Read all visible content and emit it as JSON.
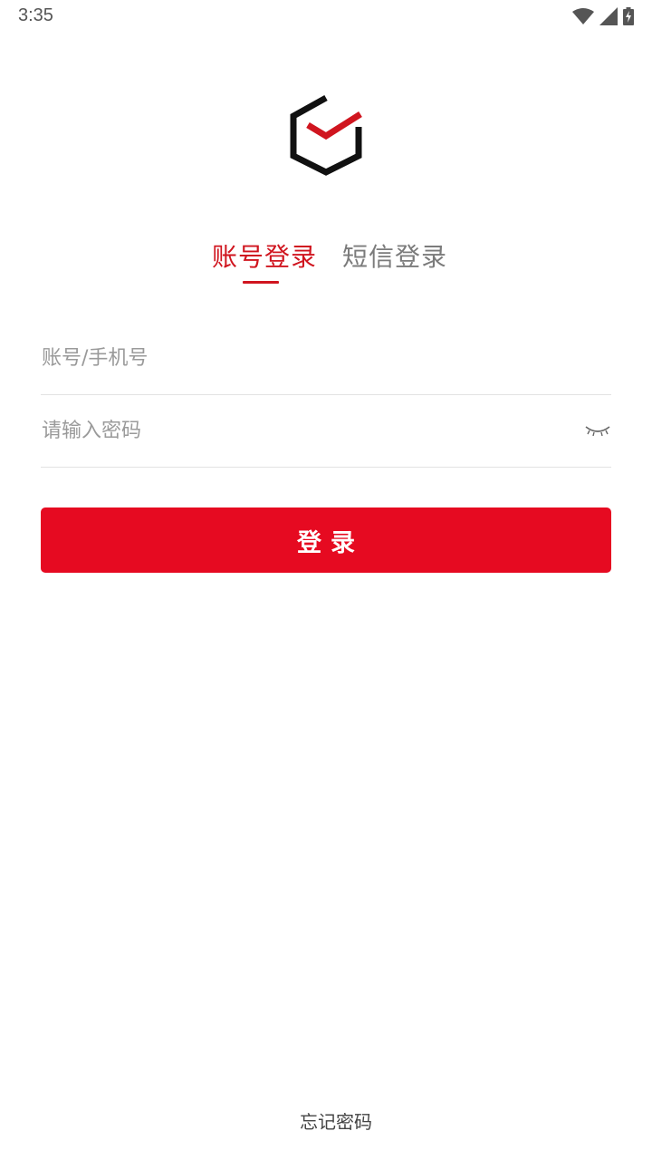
{
  "status_bar": {
    "time": "3:35",
    "icons": [
      "wifi-icon",
      "cellular-signal-icon",
      "battery-charging-icon"
    ]
  },
  "logo": {
    "icon": "hexagon-check-logo",
    "colors": {
      "outline": "#111111",
      "check": "#d0151f"
    }
  },
  "tabs": [
    {
      "label": "账号登录",
      "active": true
    },
    {
      "label": "短信登录",
      "active": false
    }
  ],
  "form": {
    "account": {
      "value": "",
      "placeholder": "账号/手机号"
    },
    "password": {
      "value": "",
      "placeholder": "请输入密码",
      "toggle_icon": "eye-closed-icon"
    }
  },
  "login_button": {
    "label": "登录"
  },
  "forgot_password": {
    "label": "忘记密码"
  },
  "colors": {
    "accent": "#e60a21",
    "active_tab": "#d0151f",
    "inactive_tab": "#7b7b7b",
    "placeholder": "#9a9a9a"
  }
}
